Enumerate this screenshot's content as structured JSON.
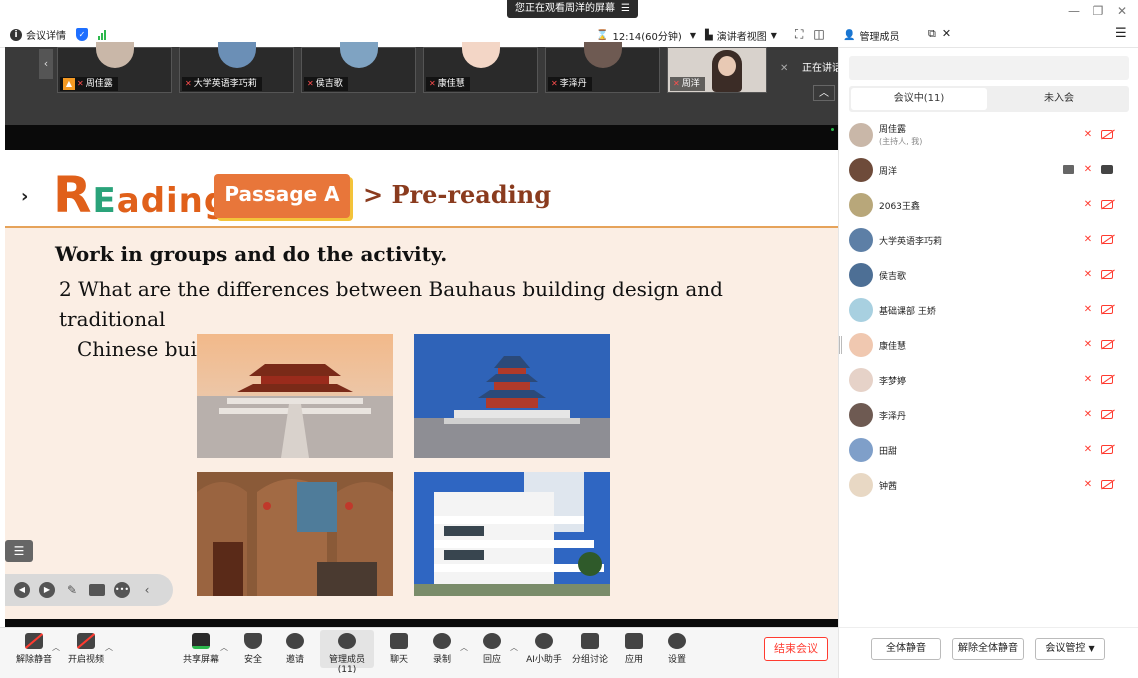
{
  "window": {
    "share_banner": "您正在观看周洋的屏幕",
    "share_menu_icon": "menu-icon",
    "minimize": "—",
    "restore": "❐",
    "close": "✕"
  },
  "topbar": {
    "meeting_info": "会议详情",
    "timer": "12:14(60分钟)",
    "view_mode": "演讲者视图",
    "manage_title": "管理成员"
  },
  "video_strip": {
    "tiles": [
      {
        "name": "周佳露",
        "avatar_color": "#c9b7a8"
      },
      {
        "name": "大学英语李巧莉",
        "avatar_color": "#6b8fb6"
      },
      {
        "name": "侯吉歌",
        "avatar_color": "#7fa3c2"
      },
      {
        "name": "康佳慧",
        "avatar_color": "#f3d6c6"
      },
      {
        "name": "李泽丹",
        "avatar_color": "#6e5a52"
      },
      {
        "name": "周洋",
        "avatar_color": "#3b2c26"
      }
    ],
    "speaking_label": "正在讲话:"
  },
  "slide": {
    "reading_r": "R",
    "reading_e": "E",
    "reading_rest": "ading",
    "passage": "Passage A",
    "pre_reading": "> Pre-reading",
    "task": "Work in groups and do the activity.",
    "question_line1": "2 What are the differences between Bauhaus building design and  traditional",
    "question_line2": "Chinese building design?"
  },
  "bottom_toolbar": {
    "unmute": "解除静音",
    "start_video": "开启视频",
    "share_screen": "共享屏幕",
    "security": "安全",
    "invite": "邀请",
    "manage_members": "管理成员(11)",
    "chat": "聊天",
    "record": "录制",
    "playback": "回应",
    "ai_assistant": "AI小助手",
    "breakout": "分组讨论",
    "apps": "应用",
    "settings": "设置",
    "end_meeting": "结束会议"
  },
  "panel": {
    "tab_in_meeting": "会议中(11)",
    "tab_not_joined": "未入会",
    "participants": [
      {
        "name": "周佳露",
        "role": "(主持人, 我)",
        "avatar_color": "#c9b7a8"
      },
      {
        "name": "周洋",
        "role": "",
        "avatar_color": "#6e4b3a"
      },
      {
        "name": "2063王鑫",
        "role": "",
        "avatar_color": "#b8a77a"
      },
      {
        "name": "大学英语李巧莉",
        "role": "",
        "avatar_color": "#5d7fa6"
      },
      {
        "name": "侯吉歌",
        "role": "",
        "avatar_color": "#4d6f95"
      },
      {
        "name": "基础课部 王娇",
        "role": "",
        "avatar_color": "#a8d0e0"
      },
      {
        "name": "康佳慧",
        "role": "",
        "avatar_color": "#f0c8b0"
      },
      {
        "name": "李梦婷",
        "role": "",
        "avatar_color": "#e6d2c8"
      },
      {
        "name": "李泽丹",
        "role": "",
        "avatar_color": "#6e5a52"
      },
      {
        "name": "田甜",
        "role": "",
        "avatar_color": "#7f9fc9"
      },
      {
        "name": "钟茜",
        "role": "",
        "avatar_color": "#e8d8c4"
      }
    ],
    "mute_all": "全体静音",
    "unmute_all": "解除全体静音",
    "meeting_control": "会议管控"
  },
  "colors": {
    "accent_red": "#ff3b30",
    "accent_blue": "#1e6fff",
    "slide_orange": "#e8763a"
  }
}
